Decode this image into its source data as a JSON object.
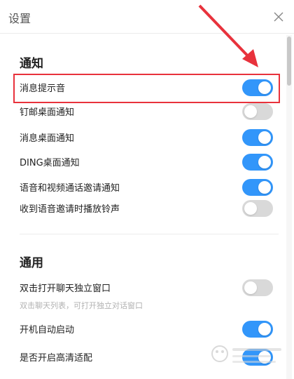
{
  "window": {
    "title": "设置"
  },
  "sections": {
    "notify": {
      "title": "通知",
      "items": [
        {
          "label": "消息提示音",
          "on": true
        },
        {
          "label": "钉邮桌面通知",
          "on": false
        },
        {
          "label": "消息桌面通知",
          "on": true
        },
        {
          "label": "DING桌面通知",
          "on": true
        },
        {
          "label": "语音和视频通话邀请通知",
          "on": true
        },
        {
          "label": "收到语音邀请时播放铃声",
          "on": false
        }
      ]
    },
    "general": {
      "title": "通用",
      "items": [
        {
          "label": "双击打开聊天独立窗口",
          "sub": "双击聊天列表，可打开独立对话窗口",
          "on": false
        },
        {
          "label": "开机自动启动",
          "on": true
        },
        {
          "label": "是否开启高清适配",
          "on": true
        }
      ]
    }
  },
  "colors": {
    "toggle_on": "#3296fa",
    "toggle_off": "#d9d9d9",
    "annotation": "#e8323c"
  },
  "icons": {
    "close": "close-icon",
    "arrow": "arrow-annotation-icon"
  }
}
